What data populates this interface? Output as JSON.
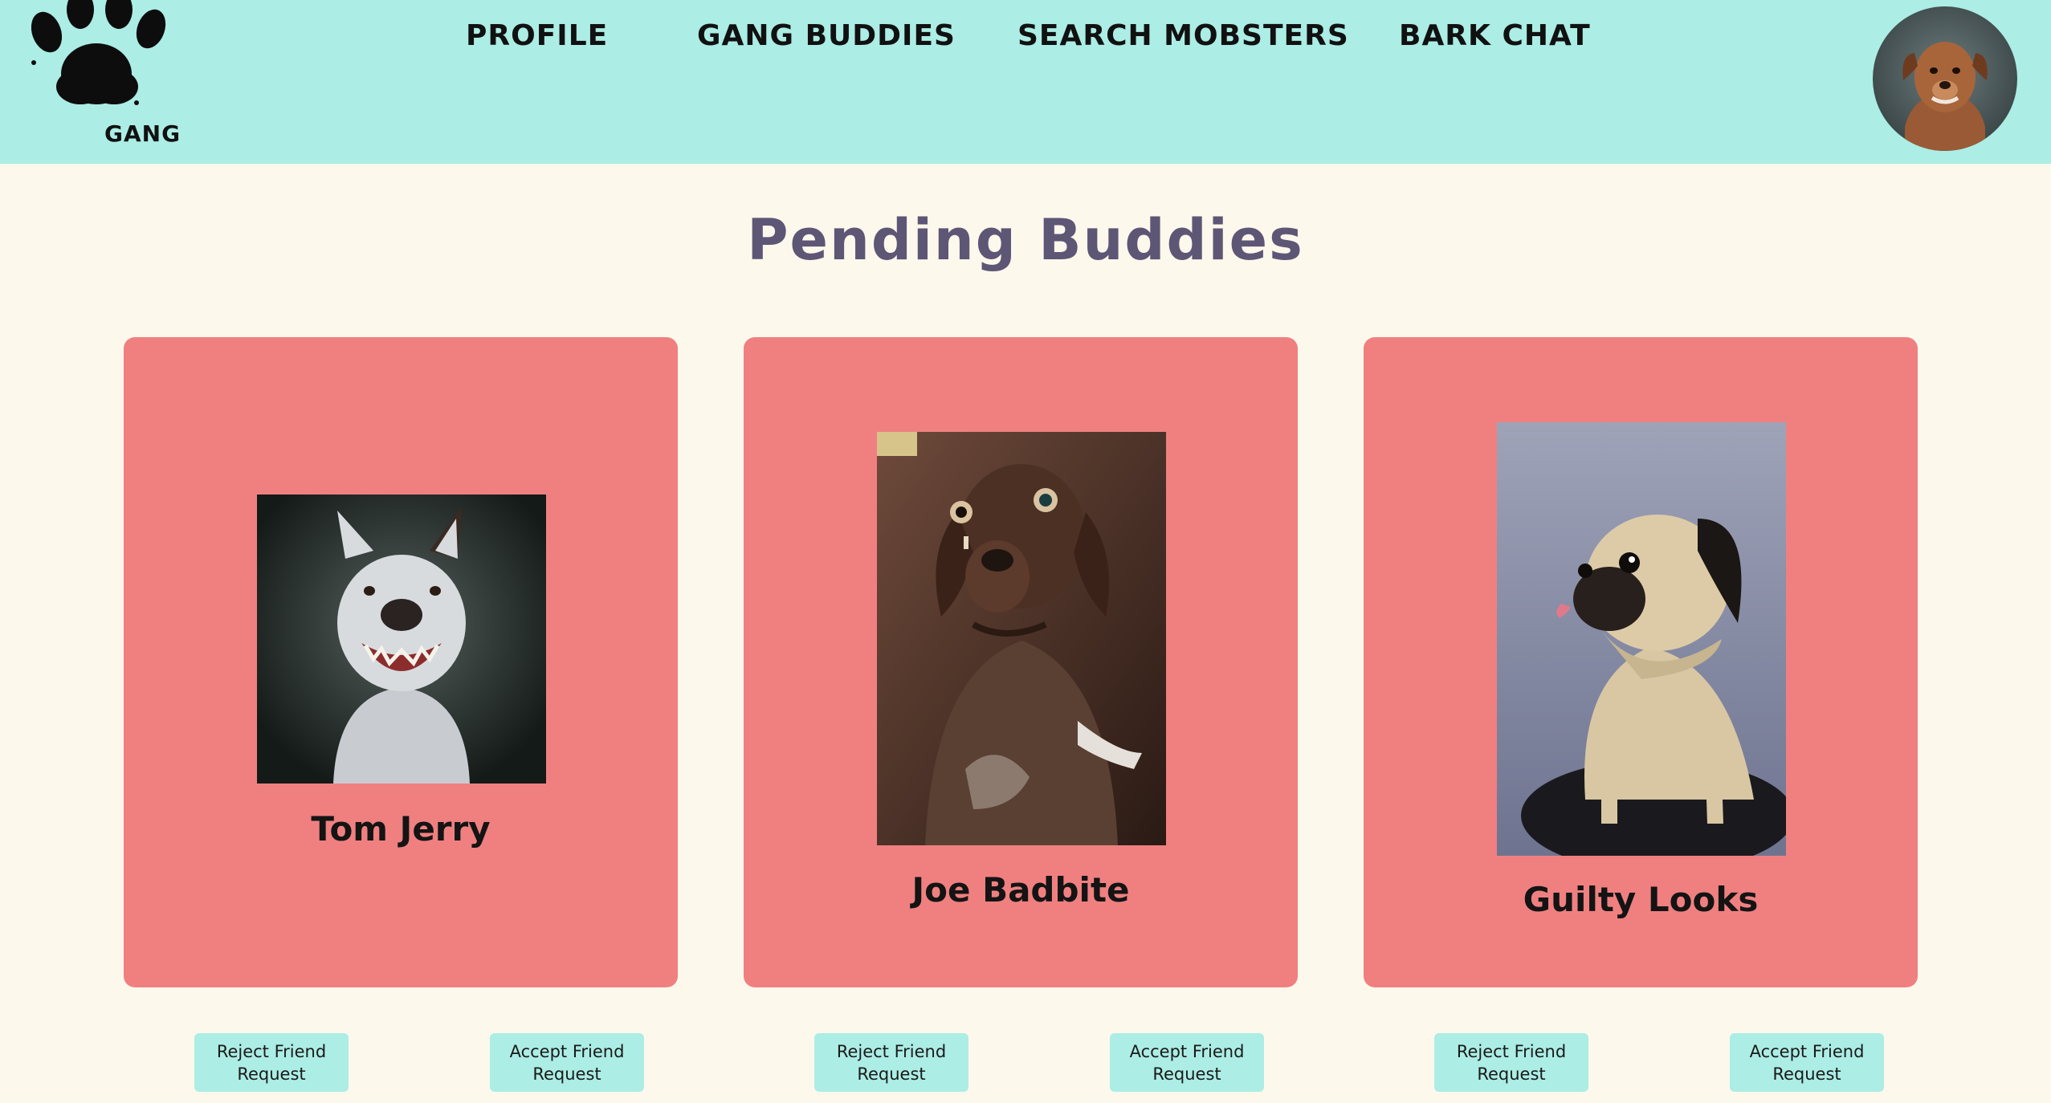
{
  "header": {
    "logo_text": "GANG",
    "nav": [
      {
        "label": "PROFILE"
      },
      {
        "label": "GANG BUDDIES"
      },
      {
        "label": "SEARCH MOBSTERS"
      },
      {
        "label": "BARK CHAT"
      }
    ],
    "avatar_icon": "dog-avatar",
    "background": "#acede5"
  },
  "main": {
    "title": "Pending Buddies",
    "cards": [
      {
        "name": "Tom Jerry",
        "reject_label": [
          "Reject Friend",
          "Request"
        ],
        "accept_label": [
          "Accept Friend",
          "Request"
        ]
      },
      {
        "name": "Joe Badbite",
        "reject_label": [
          "Reject Friend",
          "Request"
        ],
        "accept_label": [
          "Accept Friend",
          "Request"
        ]
      },
      {
        "name": "Guilty Looks",
        "reject_label": [
          "Reject Friend",
          "Request"
        ],
        "accept_label": [
          "Accept Friend",
          "Request"
        ]
      }
    ]
  },
  "colors": {
    "page_bg": "#fdf8ec",
    "header_bg": "#acede5",
    "card_bg": "#f08080",
    "title": "#5e5675",
    "button_bg": "#acede5"
  }
}
